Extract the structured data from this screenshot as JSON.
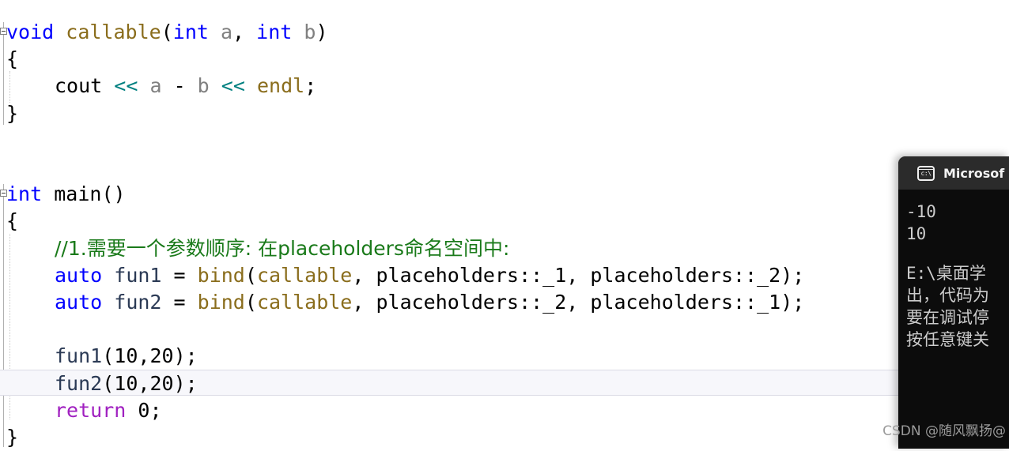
{
  "editor": {
    "background": "#ffffff",
    "current_line_index": 12,
    "lines": [
      {
        "indent": 0,
        "tokens": [
          {
            "t": "void",
            "c": "kw"
          },
          {
            "t": " ",
            "c": "punct"
          },
          {
            "t": "callable",
            "c": "fn"
          },
          {
            "t": "(",
            "c": "punct"
          },
          {
            "t": "int",
            "c": "kw"
          },
          {
            "t": " ",
            "c": "punct"
          },
          {
            "t": "a",
            "c": "var"
          },
          {
            "t": ", ",
            "c": "punct"
          },
          {
            "t": "int",
            "c": "kw"
          },
          {
            "t": " ",
            "c": "punct"
          },
          {
            "t": "b",
            "c": "var"
          },
          {
            "t": ")",
            "c": "punct"
          }
        ]
      },
      {
        "indent": 0,
        "tokens": [
          {
            "t": "{",
            "c": "brace"
          }
        ]
      },
      {
        "indent": 1,
        "tokens": [
          {
            "t": "cout",
            "c": "punct"
          },
          {
            "t": " ",
            "c": "punct"
          },
          {
            "t": "<<",
            "c": "op"
          },
          {
            "t": " ",
            "c": "punct"
          },
          {
            "t": "a",
            "c": "var"
          },
          {
            "t": " - ",
            "c": "punct"
          },
          {
            "t": "b",
            "c": "var"
          },
          {
            "t": " ",
            "c": "punct"
          },
          {
            "t": "<<",
            "c": "op"
          },
          {
            "t": " ",
            "c": "punct"
          },
          {
            "t": "endl",
            "c": "fn"
          },
          {
            "t": ";",
            "c": "punct"
          }
        ]
      },
      {
        "indent": 0,
        "tokens": [
          {
            "t": "}",
            "c": "brace"
          }
        ]
      },
      {
        "indent": 0,
        "tokens": []
      },
      {
        "indent": 0,
        "tokens": []
      },
      {
        "indent": 0,
        "tokens": [
          {
            "t": "int",
            "c": "kw"
          },
          {
            "t": " ",
            "c": "punct"
          },
          {
            "t": "main",
            "c": "punct"
          },
          {
            "t": "()",
            "c": "punct"
          }
        ]
      },
      {
        "indent": 0,
        "tokens": [
          {
            "t": "{",
            "c": "brace"
          }
        ]
      },
      {
        "indent": 1,
        "tokens": [
          {
            "t": "//1.需要一个参数顺序: 在placeholders命名空间中:",
            "c": "cmt"
          }
        ]
      },
      {
        "indent": 1,
        "tokens": [
          {
            "t": "auto",
            "c": "kw"
          },
          {
            "t": " ",
            "c": "punct"
          },
          {
            "t": "fun1",
            "c": "ident"
          },
          {
            "t": " = ",
            "c": "punct"
          },
          {
            "t": "bind",
            "c": "fn"
          },
          {
            "t": "(",
            "c": "punct"
          },
          {
            "t": "callable",
            "c": "fn"
          },
          {
            "t": ", placeholders::_1, placeholders::_2);",
            "c": "punct"
          }
        ]
      },
      {
        "indent": 1,
        "tokens": [
          {
            "t": "auto",
            "c": "kw"
          },
          {
            "t": " ",
            "c": "punct"
          },
          {
            "t": "fun2",
            "c": "ident"
          },
          {
            "t": " = ",
            "c": "punct"
          },
          {
            "t": "bind",
            "c": "fn"
          },
          {
            "t": "(",
            "c": "punct"
          },
          {
            "t": "callable",
            "c": "fn"
          },
          {
            "t": ", placeholders::_2, placeholders::_1);",
            "c": "punct"
          }
        ]
      },
      {
        "indent": 1,
        "tokens": []
      },
      {
        "indent": 1,
        "tokens": [
          {
            "t": "fun1",
            "c": "ident"
          },
          {
            "t": "(",
            "c": "punct"
          },
          {
            "t": "10",
            "c": "num"
          },
          {
            "t": ",",
            "c": "punct"
          },
          {
            "t": "20",
            "c": "num"
          },
          {
            "t": ");",
            "c": "punct"
          }
        ]
      },
      {
        "indent": 1,
        "tokens": [
          {
            "t": "fun2",
            "c": "ident"
          },
          {
            "t": "(",
            "c": "punct"
          },
          {
            "t": "10",
            "c": "num"
          },
          {
            "t": ",",
            "c": "punct"
          },
          {
            "t": "20",
            "c": "num"
          },
          {
            "t": ");",
            "c": "punct"
          }
        ]
      },
      {
        "indent": 1,
        "tokens": [
          {
            "t": "return",
            "c": "kwctl"
          },
          {
            "t": " ",
            "c": "punct"
          },
          {
            "t": "0",
            "c": "num"
          },
          {
            "t": ";",
            "c": "punct"
          }
        ]
      },
      {
        "indent": 0,
        "tokens": [
          {
            "t": "}",
            "c": "brace"
          }
        ]
      }
    ]
  },
  "console": {
    "icon": "command-prompt-icon",
    "icon_glyph": "c:\\",
    "title": "Microsof",
    "title_full": "Microsoft Visual Studio 调试控制台",
    "titlebar_color": "#2b2b2b",
    "body_color": "#0c0c0c",
    "text_color": "#cccccc",
    "output": [
      "-10",
      "10",
      "",
      "E:\\桌面学",
      "出，代码为",
      "要在调试停",
      "按任意键关"
    ]
  },
  "watermark": {
    "text": "CSDN @随风飘扬@"
  }
}
